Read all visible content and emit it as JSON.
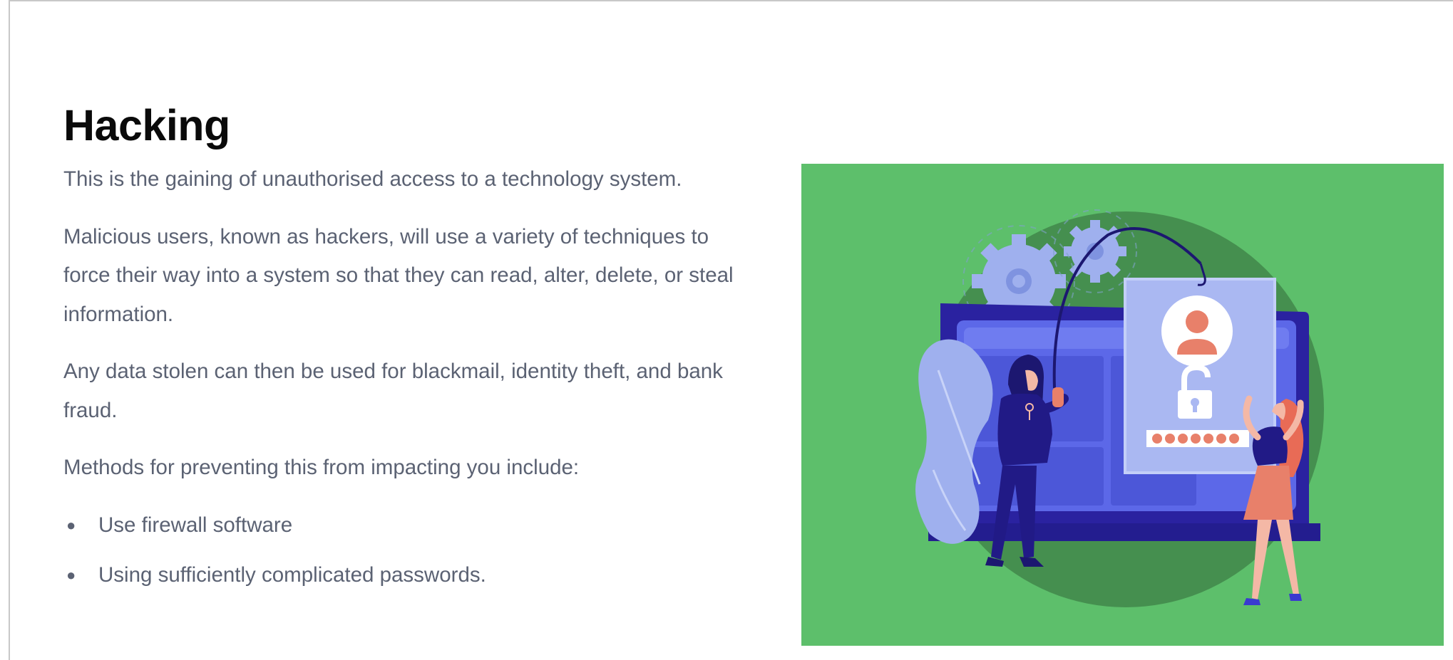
{
  "page": {
    "title": "Hacking",
    "paragraphs": [
      "This is the gaining of unauthorised access to a technology system.",
      "Malicious users, known as hackers, will use a variety of techniques to force their way into a system so that they can read, alter, delete, or steal information.",
      "Any data stolen can then be used for blackmail, identity theft, and bank fraud.",
      "Methods for preventing this from impacting you include:"
    ],
    "bullets": [
      "Use firewall software",
      "Using sufficiently complicated passwords."
    ]
  },
  "illustration": {
    "icon_name": "phishing-hacker-illustration",
    "colors": {
      "background": "#5dbf6b",
      "circle": "#458f4f",
      "laptop_frame": "#2a22a0",
      "laptop_screen": "#5c68e8",
      "card": "#aab8f2",
      "accent_coral": "#e8806a",
      "gear": "#9fb0ee"
    }
  }
}
